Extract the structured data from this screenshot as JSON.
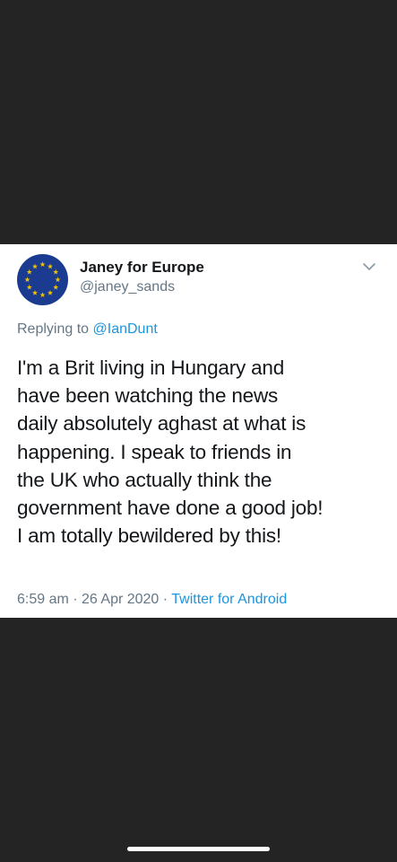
{
  "tweet": {
    "display_name": "Janey for Europe",
    "handle": "@janey_sands",
    "replying_prefix": "Replying to ",
    "replying_to": "@IanDunt",
    "text_lines": [
      "I'm a Brit living in Hungary and",
      "have been watching the news",
      "daily absolutely aghast at what is",
      "happening.  I speak to friends in",
      "the UK who actually think the",
      "government have done a good job!",
      "I am totally bewildered by this!"
    ],
    "time": "6:59 am",
    "separator": " · ",
    "date": "26 Apr 2020",
    "source": "Twitter for Android"
  },
  "icons": {
    "avatar": "eu-flag-icon",
    "menu": "chevron-down-icon"
  },
  "colors": {
    "background": "#242424",
    "card": "#ffffff",
    "text": "#14171a",
    "secondary": "#657786",
    "link": "#1b95e0",
    "eu_blue": "#003399",
    "eu_gold": "#ffcc00"
  }
}
